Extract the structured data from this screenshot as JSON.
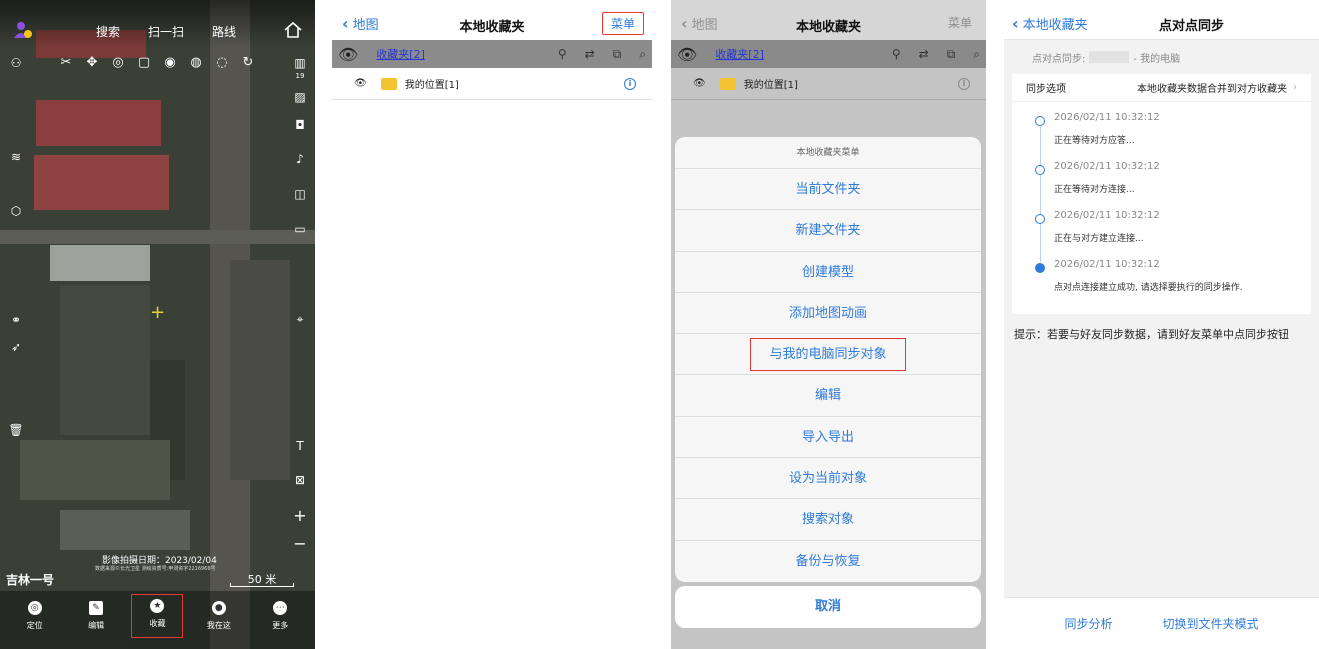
{
  "panel1": {
    "topnav": [
      "搜索",
      "扫一扫",
      "路线"
    ],
    "badge_number": "19",
    "capture_date": "影像拍摄日期：2023/02/04",
    "credit": "数据来源©长光卫星 测绘资质号:甲测资字2216966号",
    "brand": "吉林一号",
    "scale": "50 米",
    "tabs": [
      {
        "label": "定位",
        "icon": "locate-icon"
      },
      {
        "label": "编辑",
        "icon": "edit-icon"
      },
      {
        "label": "收藏",
        "icon": "star-icon"
      },
      {
        "label": "我在这",
        "icon": "pin-icon"
      },
      {
        "label": "更多",
        "icon": "more-icon"
      }
    ]
  },
  "panel2": {
    "back_label": "地图",
    "title": "本地收藏夹",
    "menu_label": "菜单",
    "folder_label": "收藏夹[2]",
    "item_label": "我的位置[1]"
  },
  "panel3": {
    "back_label": "地图",
    "title": "本地收藏夹",
    "menu_label": "菜单",
    "folder_label": "收藏夹[2]",
    "item_label": "我的位置[1]",
    "sheet_title": "本地收藏夹菜单",
    "sheet_items": [
      "当前文件夹",
      "新建文件夹",
      "创建模型",
      "添加地图动画",
      "与我的电脑同步对象",
      "编辑",
      "导入导出",
      "设为当前对象",
      "搜索对象",
      "备份与恢复"
    ],
    "cancel_label": "取消"
  },
  "panel4": {
    "back_label": "本地收藏夹",
    "title": "点对点同步",
    "peer_prefix": "点对点同步:",
    "peer_suffix": "- 我的电脑",
    "option_label": "同步选项",
    "option_value": "本地收藏夹数据合并到对方收藏夹",
    "events": [
      {
        "time": "2026/02/11 10:32:12",
        "msg": "正在等待对方应答..."
      },
      {
        "time": "2026/02/11 10:32:12",
        "msg": "正在等待对方连接..."
      },
      {
        "time": "2026/02/11 10:32:12",
        "msg": "正在与对方建立连接..."
      },
      {
        "time": "2026/02/11 10:32:12",
        "msg": "点对点连接建立成功, 请选择要执行的同步操作."
      }
    ],
    "tip": "提示：若要与好友同步数据，请到好友菜单中点同步按钮",
    "action_left": "同步分析",
    "action_right": "切换到文件夹模式"
  },
  "colors": {
    "accent": "#2f7bd9",
    "highlight": "#e53935",
    "folder": "#f4c430"
  }
}
